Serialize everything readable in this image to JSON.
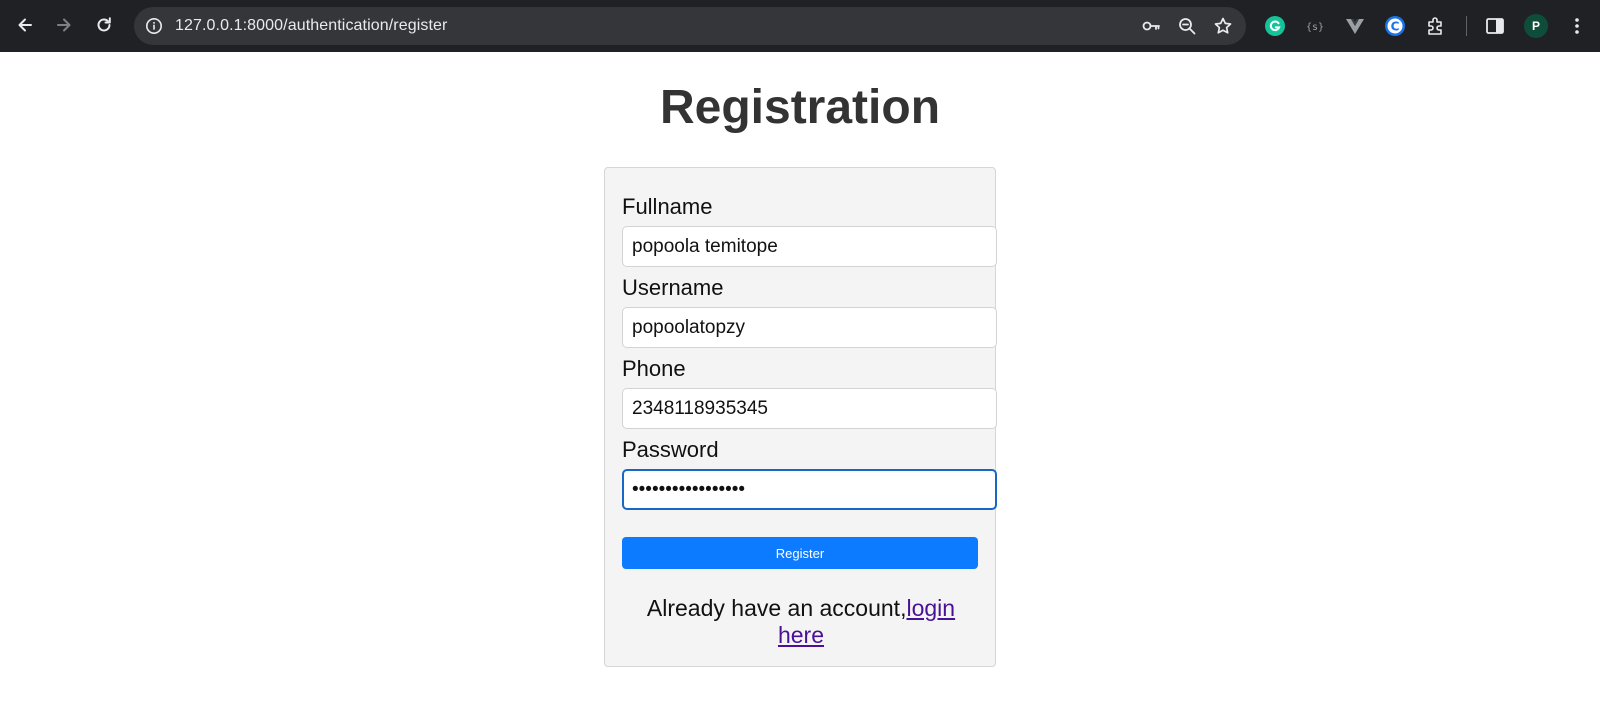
{
  "browser": {
    "url": "127.0.0.1:8000/authentication/register",
    "profile_initial": "P",
    "icons": {
      "back": "arrow-left-icon",
      "forward": "arrow-right-icon",
      "reload": "reload-icon",
      "site_info": "info-icon",
      "password_key": "key-icon",
      "zoom": "zoom-out-icon",
      "bookmark": "star-icon",
      "grammarly": "grammarly-icon",
      "extension_s": "bracket-extension-icon",
      "vue": "vue-devtools-icon",
      "extension_c": "c-extension-icon",
      "extensions": "puzzle-icon",
      "side_panel": "side-panel-icon",
      "menu": "kebab-menu-icon"
    }
  },
  "page": {
    "title": "Registration"
  },
  "form": {
    "fullname_label": "Fullname",
    "fullname_value": "popoola temitope",
    "username_label": "Username",
    "username_value": "popoolatopzy",
    "phone_label": "Phone",
    "phone_value": "2348118935345",
    "password_label": "Password",
    "password_value": "•••••••••••••••••",
    "register_label": "Register",
    "login_prompt": "Already have an account,",
    "login_link_part1": "login",
    "login_link_part2": "here"
  },
  "colors": {
    "chrome_bg": "#202124",
    "omnibox_bg": "#35363a",
    "button_primary": "#0d7bff",
    "link_visited": "#4a1197",
    "focus_border": "#1a66c4",
    "card_bg": "#f4f4f4"
  }
}
